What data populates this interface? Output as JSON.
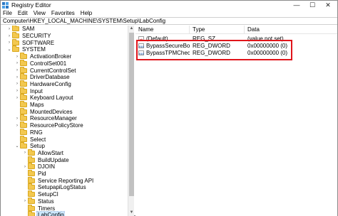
{
  "window": {
    "title": "Registry Editor",
    "controls": {
      "minimize": "—",
      "maximize": "☐",
      "close": "✕"
    }
  },
  "menu": [
    "File",
    "Edit",
    "View",
    "Favorites",
    "Help"
  ],
  "address": "Computer\\HKEY_LOCAL_MACHINE\\SYSTEM\\Setup\\LabConfig",
  "tree": [
    {
      "label": "SAM",
      "indent": 2,
      "expander": "›"
    },
    {
      "label": "SECURITY",
      "indent": 2,
      "expander": "›"
    },
    {
      "label": "SOFTWARE",
      "indent": 2,
      "expander": "›"
    },
    {
      "label": "SYSTEM",
      "indent": 2,
      "expander": "⌄"
    },
    {
      "label": "ActivationBroker",
      "indent": 3,
      "expander": "›"
    },
    {
      "label": "ControlSet001",
      "indent": 3,
      "expander": "›"
    },
    {
      "label": "CurrentControlSet",
      "indent": 3,
      "expander": "›"
    },
    {
      "label": "DriverDatabase",
      "indent": 3,
      "expander": "›"
    },
    {
      "label": "HardwareConfig",
      "indent": 3,
      "expander": "›"
    },
    {
      "label": "Input",
      "indent": 3,
      "expander": "›"
    },
    {
      "label": "Keyboard Layout",
      "indent": 3,
      "expander": "›"
    },
    {
      "label": "Maps",
      "indent": 3,
      "expander": ""
    },
    {
      "label": "MountedDevices",
      "indent": 3,
      "expander": ""
    },
    {
      "label": "ResourceManager",
      "indent": 3,
      "expander": "›"
    },
    {
      "label": "ResourcePolicyStore",
      "indent": 3,
      "expander": "›"
    },
    {
      "label": "RNG",
      "indent": 3,
      "expander": ""
    },
    {
      "label": "Select",
      "indent": 3,
      "expander": ""
    },
    {
      "label": "Setup",
      "indent": 3,
      "expander": "⌄"
    },
    {
      "label": "AllowStart",
      "indent": 4,
      "expander": "›"
    },
    {
      "label": "BuildUpdate",
      "indent": 4,
      "expander": ""
    },
    {
      "label": "DJOIN",
      "indent": 4,
      "expander": "›"
    },
    {
      "label": "Pid",
      "indent": 4,
      "expander": ""
    },
    {
      "label": "Service Reporting API",
      "indent": 4,
      "expander": ""
    },
    {
      "label": "SetupapiLogStatus",
      "indent": 4,
      "expander": ""
    },
    {
      "label": "SetupCI",
      "indent": 4,
      "expander": ""
    },
    {
      "label": "Status",
      "indent": 4,
      "expander": "›"
    },
    {
      "label": "Timers",
      "indent": 4,
      "expander": ""
    },
    {
      "label": "LabConfig",
      "indent": 4,
      "expander": "",
      "selected": true
    }
  ],
  "list": {
    "columns": {
      "name": "Name",
      "type": "Type",
      "data": "Data"
    },
    "rows": [
      {
        "name": "(Default)",
        "type": "REG_SZ",
        "data": "(value not set)",
        "icon": "string-value-icon",
        "icon_text": "ab"
      },
      {
        "name": "BypassSecureBo...",
        "type": "REG_DWORD",
        "data": "0x00000000 (0)",
        "icon": "dword-value-icon",
        "icon_text": "010"
      },
      {
        "name": "BypassTPMCheck",
        "type": "REG_DWORD",
        "data": "0x00000000 (0)",
        "icon": "dword-value-icon",
        "icon_text": "010"
      }
    ]
  },
  "colors": {
    "highlight": "#e0151b",
    "selection": "#cce8ff",
    "folder": "#f3c84f"
  }
}
